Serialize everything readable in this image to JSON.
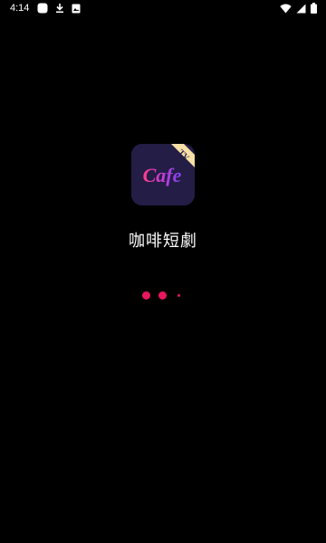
{
  "status_bar": {
    "time": "4:14",
    "left_icons": [
      "app-notification-icon",
      "download-icon",
      "photo-icon"
    ],
    "right_icons": [
      "wifi-icon",
      "cellular-signal-icon",
      "battery-icon"
    ]
  },
  "splash": {
    "logo_text": "Cafe",
    "logo_badge": "TV",
    "app_name": "咖啡短劇"
  },
  "loading": {
    "dot_count": 3,
    "color": "#e8175d"
  },
  "colors": {
    "background": "#000000",
    "logo_background": "#241d46",
    "logo_badge_background": "#f7e0a6",
    "accent": "#e8175d"
  }
}
